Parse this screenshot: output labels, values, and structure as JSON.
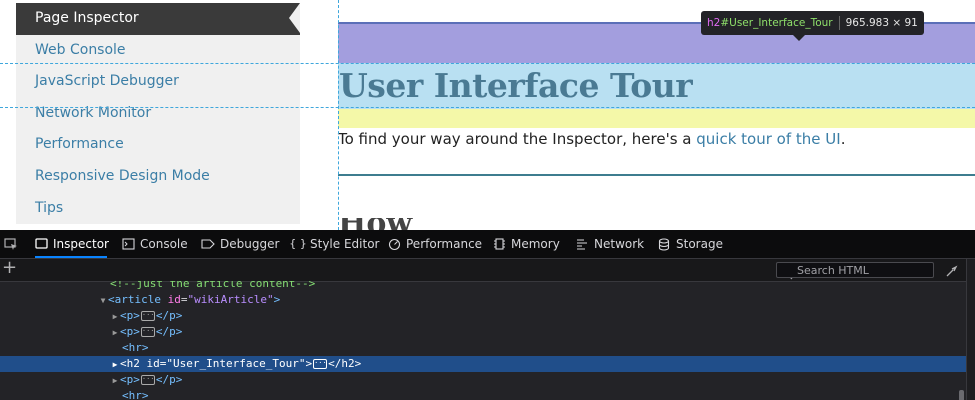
{
  "sidebar": {
    "items": [
      {
        "label": "Page Inspector",
        "active": true
      },
      {
        "label": "Web Console"
      },
      {
        "label": "JavaScript Debugger"
      },
      {
        "label": "Network Monitor"
      },
      {
        "label": "Performance"
      },
      {
        "label": "Responsive Design Mode"
      },
      {
        "label": "Tips"
      }
    ]
  },
  "content": {
    "heading": "User Interface Tour",
    "para_prefix": "To find your way around the Inspector, here's a ",
    "para_link": "quick tour of the UI",
    "para_suffix": ".",
    "next_heading": "How"
  },
  "tooltip": {
    "tag": "h2",
    "id": "#User_Interface_Tour",
    "dimensions": "965.983 × 91"
  },
  "devtools": {
    "tabs": [
      {
        "label": "Inspector",
        "icon": "inspector-icon",
        "active": true
      },
      {
        "label": "Console",
        "icon": "console-icon"
      },
      {
        "label": "Debugger",
        "icon": "debugger-icon"
      },
      {
        "label": "Style Editor",
        "icon": "style-editor-icon"
      },
      {
        "label": "Performance",
        "icon": "performance-icon"
      },
      {
        "label": "Memory",
        "icon": "memory-icon"
      },
      {
        "label": "Network",
        "icon": "network-icon"
      },
      {
        "label": "Storage",
        "icon": "storage-icon"
      }
    ],
    "search_placeholder": "Search HTML",
    "markup": {
      "comment": "<!--just the article content-->",
      "article_open": "<article",
      "article_attr": "id",
      "article_val": "\"wikiArticle\"",
      "article_close": ">",
      "p_open": "<p>",
      "p_close": "</p>",
      "hr": "<hr>",
      "h2_open": "<h2",
      "h2_attr": "id",
      "h2_val": "\"User_Interface_Tour\"",
      "h2_gt": ">",
      "h2_close": "</h2>"
    }
  },
  "colors": {
    "accent": "#0a84ff",
    "margin_highlight": "#a39ede",
    "content_highlight": "#b9e0f2",
    "padding_highlight": "#f4f8a8",
    "selected_row": "#204e8a"
  }
}
